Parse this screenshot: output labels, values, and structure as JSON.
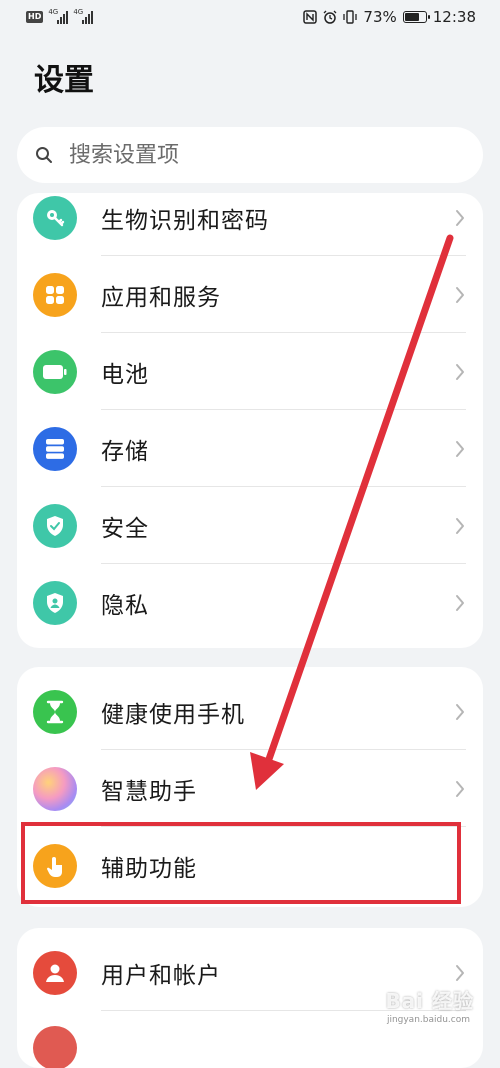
{
  "status_bar": {
    "hd": "HD",
    "net1": "4G",
    "net2": "4G",
    "battery_percent_text": "73%",
    "battery_level": 0.73,
    "time": "12:38"
  },
  "page_title": "设置",
  "search": {
    "placeholder": "搜索设置项"
  },
  "group1": [
    {
      "label": "生物识别和密码",
      "icon": "key-icon",
      "color": "#3fc7a8"
    },
    {
      "label": "应用和服务",
      "icon": "apps-grid-icon",
      "color": "#f7a31c"
    },
    {
      "label": "电池",
      "icon": "battery-icon",
      "color": "#3cc46a"
    },
    {
      "label": "存储",
      "icon": "storage-icon",
      "color": "#2d6ce5"
    },
    {
      "label": "安全",
      "icon": "shield-check-icon",
      "color": "#3fc7a8"
    },
    {
      "label": "隐私",
      "icon": "privacy-shield-icon",
      "color": "#3fc7a8"
    }
  ],
  "group2": [
    {
      "label": "健康使用手机",
      "icon": "hourglass-icon",
      "color": "#39c44f"
    },
    {
      "label": "智慧助手",
      "icon": "assistant-orb-icon",
      "color": "#b58cf0"
    },
    {
      "label": "辅助功能",
      "icon": "hand-tap-icon",
      "color": "#f7a31c"
    }
  ],
  "group3": [
    {
      "label": "用户和帐户",
      "icon": "user-icon",
      "color": "#e54b3c"
    }
  ],
  "annotation_colors": {
    "arrow": "#e0303b",
    "box": "#e0303b"
  },
  "watermark": {
    "text": "Bai 经验",
    "sub": "jingyan.baidu.com"
  }
}
